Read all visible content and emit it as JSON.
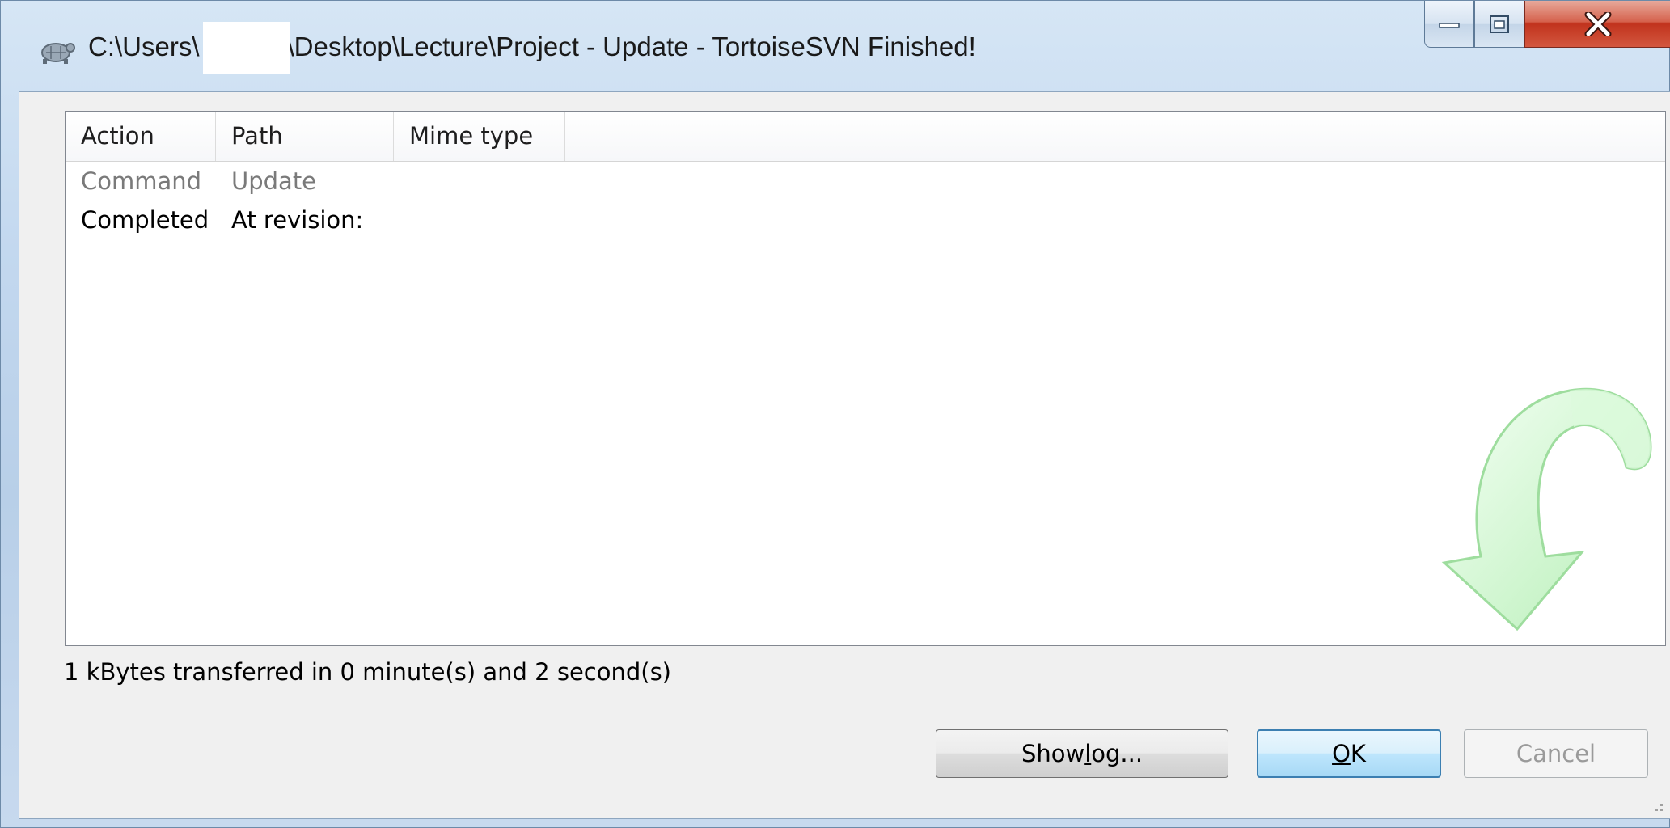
{
  "window": {
    "title_prefix": "C:\\Users\\",
    "title_suffix": "\\Desktop\\Lecture\\Project - Update - TortoiseSVN Finished!"
  },
  "list": {
    "columns": [
      "Action",
      "Path",
      "Mime type"
    ],
    "rows": [
      {
        "action": "Command",
        "path": "Update"
      },
      {
        "action": "Completed",
        "path": "At revision:"
      }
    ]
  },
  "status": "1 kBytes transferred in 0 minute(s) and 2 second(s)",
  "buttons": {
    "show_log_pre": "Show ",
    "show_log_u": "l",
    "show_log_post": "og...",
    "ok_u": "O",
    "ok_post": "K",
    "cancel": "Cancel"
  },
  "icons": {
    "app": "tortoisesvn-icon",
    "watermark": "update-arrow-icon"
  },
  "colors": {
    "close_button": "#c1331d",
    "ok_border": "#3c7fb1",
    "watermark_green": "#c8f5c8"
  }
}
